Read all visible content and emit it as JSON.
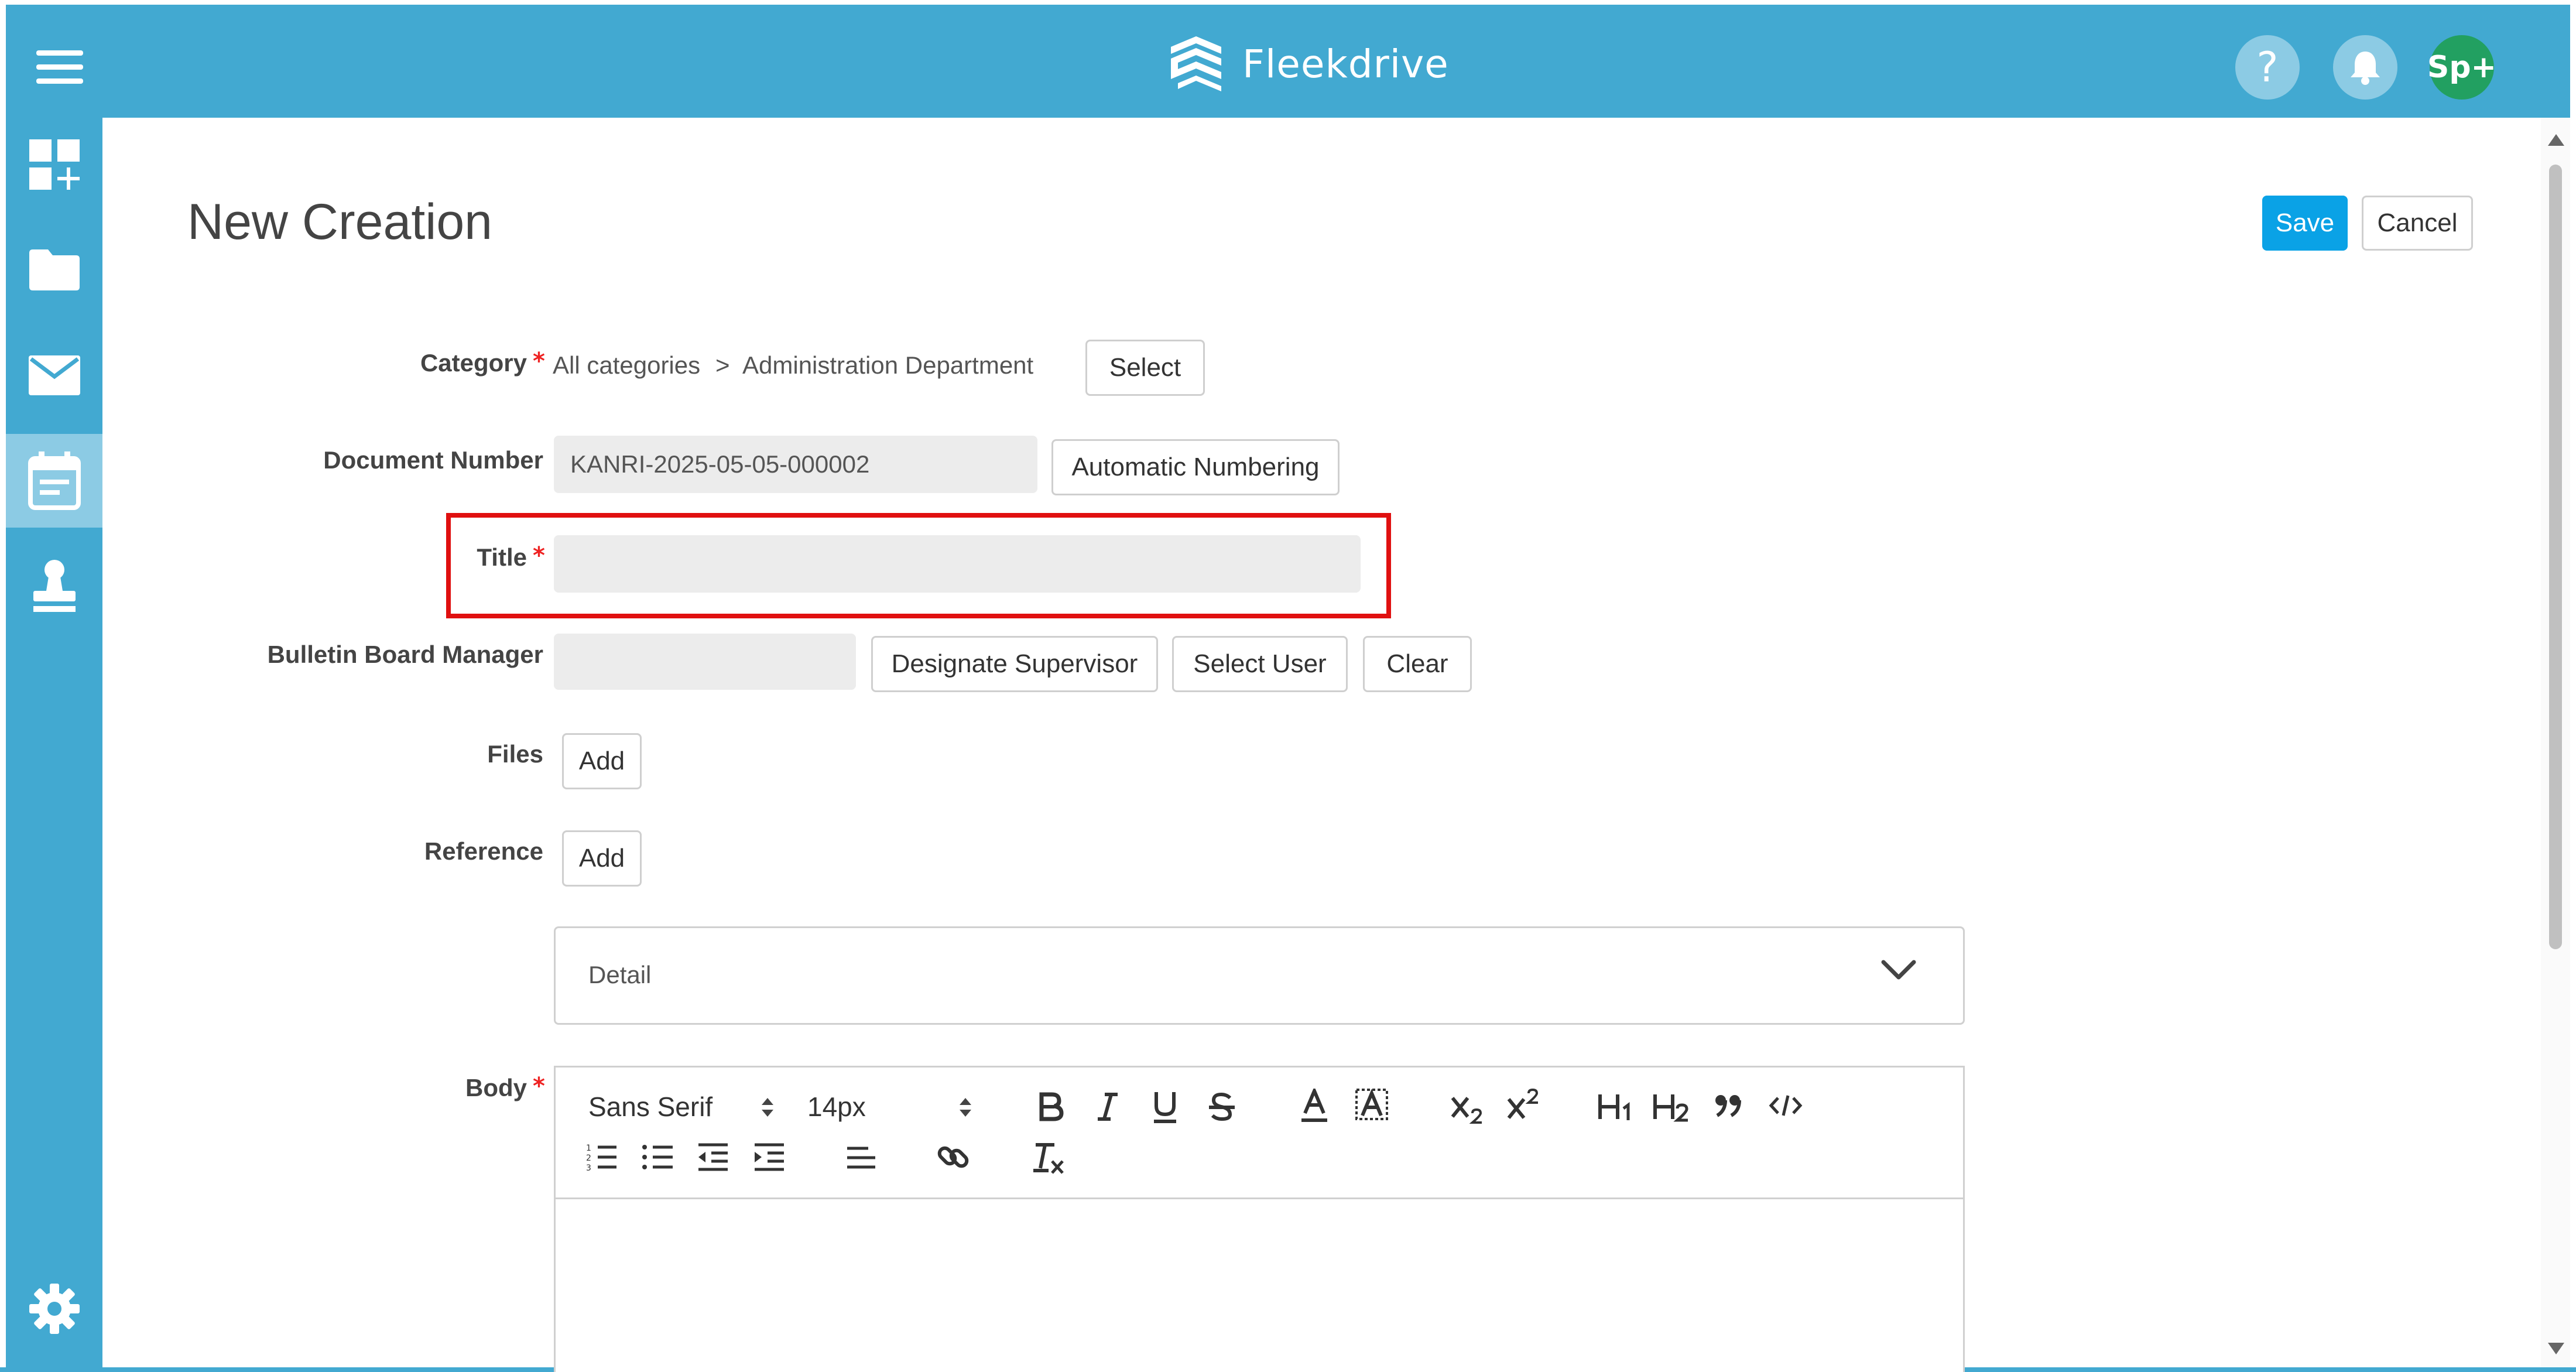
{
  "app": {
    "name": "Fleekdrive"
  },
  "header": {
    "help_icon_glyph": "?",
    "avatar_text": "Sp+"
  },
  "sidebar": {
    "items": [
      {
        "icon": "dashboard-add-icon"
      },
      {
        "icon": "folder-icon"
      },
      {
        "icon": "mail-icon"
      },
      {
        "icon": "calendar-icon",
        "active": true
      },
      {
        "icon": "stamp-icon"
      }
    ],
    "settings_icon": "gear-icon"
  },
  "page": {
    "title": "New Creation",
    "save_label": "Save",
    "cancel_label": "Cancel"
  },
  "form": {
    "required_mark": "*",
    "category": {
      "label": "Category",
      "path_root": "All categories",
      "path_sep": ">",
      "path_leaf": "Administration Department",
      "select_label": "Select"
    },
    "document_number": {
      "label": "Document Number",
      "value": "KANRI-2025-05-05-000002",
      "auto_label": "Automatic Numbering"
    },
    "title": {
      "label": "Title",
      "value": ""
    },
    "bulletin_manager": {
      "label": "Bulletin Board Manager",
      "value": "",
      "designate_label": "Designate Supervisor",
      "select_user_label": "Select User",
      "clear_label": "Clear"
    },
    "files": {
      "label": "Files",
      "add_label": "Add"
    },
    "reference": {
      "label": "Reference",
      "add_label": "Add"
    },
    "detail": {
      "label": "Detail"
    },
    "body": {
      "label": "Body",
      "font_family": "Sans Serif",
      "font_size": "14px"
    }
  },
  "colors": {
    "header": "#42a9d1",
    "primary": "#0aa2e6",
    "avatar": "#22a061",
    "highlight": "#e01010"
  }
}
